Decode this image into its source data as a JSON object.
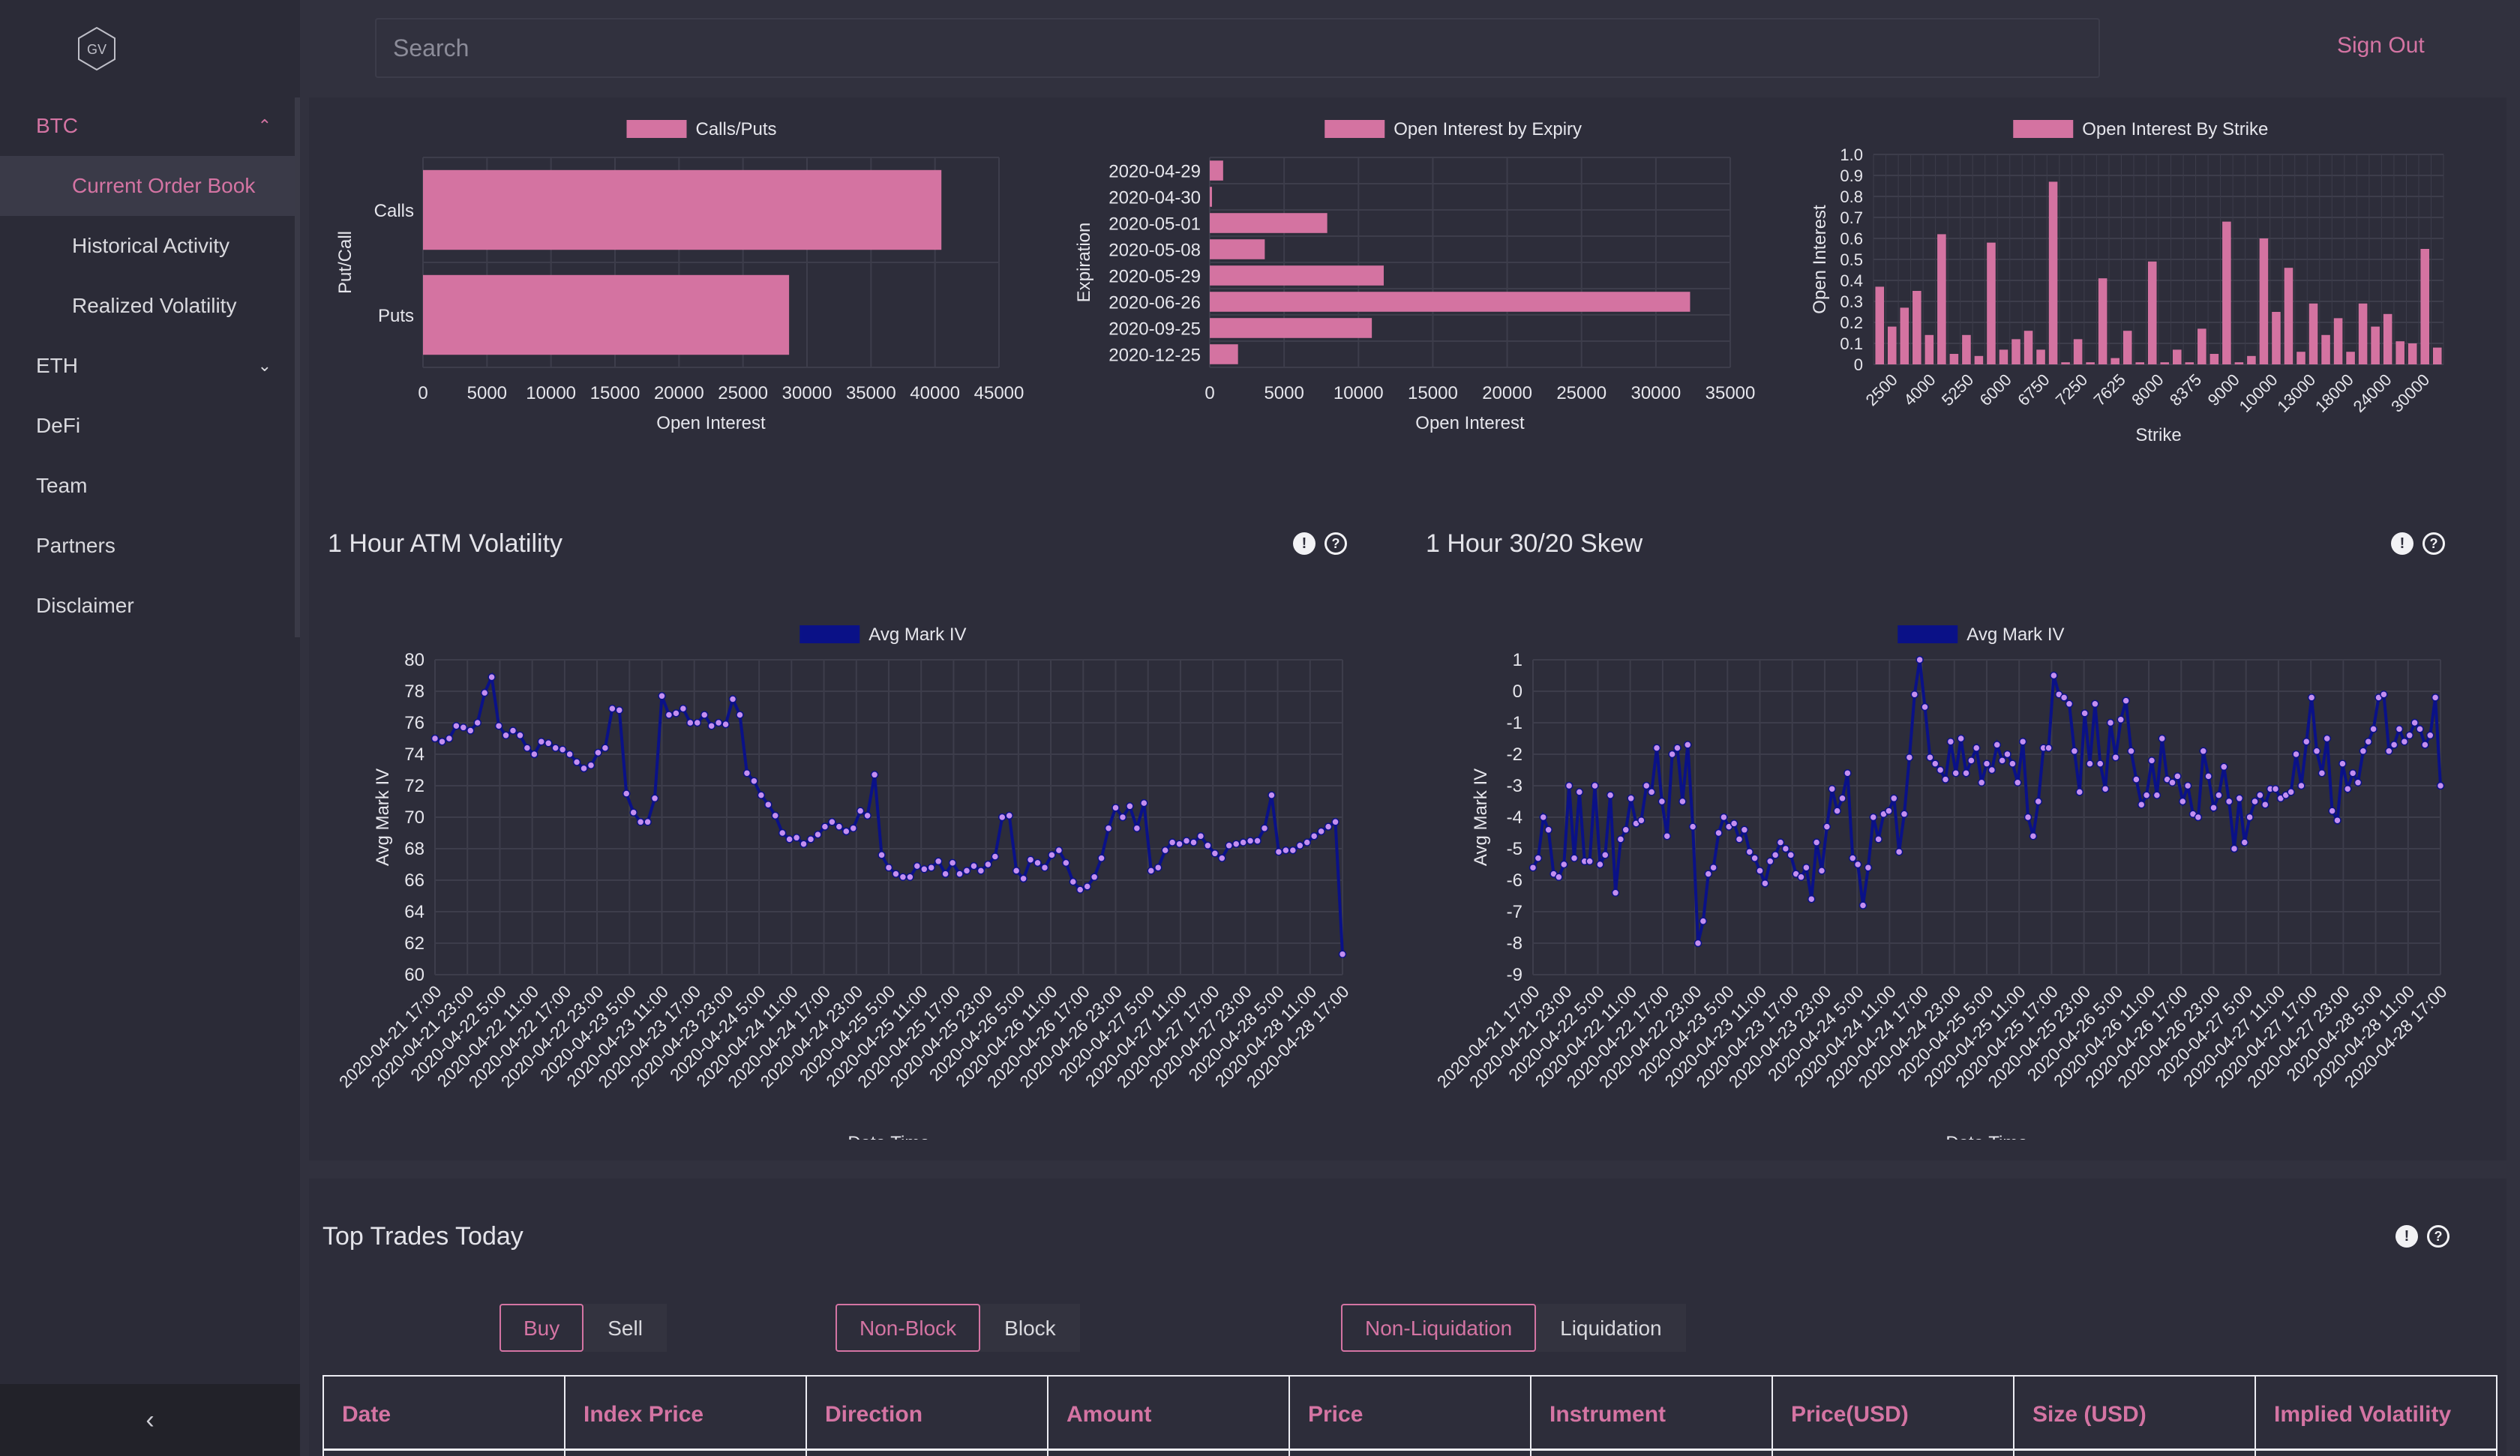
{
  "search": {
    "placeholder": "Search"
  },
  "header": {
    "sign_out": "Sign Out"
  },
  "logo": {
    "text": "GV"
  },
  "sidebar": {
    "groups": [
      {
        "label": "BTC",
        "expanded": true,
        "items": [
          "Current Order Book",
          "Historical Activity",
          "Realized Volatility"
        ],
        "current": "Current Order Book"
      },
      {
        "label": "ETH",
        "expanded": false
      }
    ],
    "links": [
      "DeFi",
      "Team",
      "Partners",
      "Disclaimer"
    ],
    "collapse_icon": "chevron-left-icon"
  },
  "colors": {
    "accent": "#d474a3",
    "bar": "#d473a1",
    "line": "#0a1187",
    "marker": "#c48ef0"
  },
  "chart_data": [
    {
      "type": "bar",
      "orientation": "horizontal",
      "legend": "Calls/Puts",
      "categories": [
        "Calls",
        "Puts"
      ],
      "values": [
        40500,
        28600
      ],
      "xlabel": "Open Interest",
      "ylabel": "Put/Call",
      "xlim": [
        0,
        45000
      ],
      "xticks": [
        0,
        5000,
        10000,
        15000,
        20000,
        25000,
        30000,
        35000,
        40000,
        45000
      ]
    },
    {
      "type": "bar",
      "orientation": "horizontal",
      "legend": "Open Interest by Expiry",
      "categories": [
        "2020-04-29",
        "2020-04-30",
        "2020-05-01",
        "2020-05-08",
        "2020-05-29",
        "2020-06-26",
        "2020-09-25",
        "2020-12-25"
      ],
      "values": [
        900,
        150,
        7900,
        3700,
        11700,
        32300,
        10900,
        1900
      ],
      "xlabel": "Open Interest",
      "ylabel": "Expiration",
      "xlim": [
        0,
        35000
      ],
      "xticks": [
        0,
        5000,
        10000,
        15000,
        20000,
        25000,
        30000,
        35000
      ]
    },
    {
      "type": "bar",
      "legend": "Open Interest By Strike",
      "tick_labels": [
        "2500",
        "4000",
        "5250",
        "6000",
        "6750",
        "7250",
        "7625",
        "8000",
        "8375",
        "9000",
        "10000",
        "13000",
        "18000",
        "24000",
        "30000"
      ],
      "values": [
        0.37,
        0.18,
        0.27,
        0.35,
        0.14,
        0.62,
        0.05,
        0.14,
        0.04,
        0.58,
        0.07,
        0.12,
        0.16,
        0.07,
        0.87,
        0.01,
        0.12,
        0.01,
        0.41,
        0.03,
        0.16,
        0.01,
        0.49,
        0.01,
        0.07,
        0.01,
        0.17,
        0.05,
        0.68,
        0.01,
        0.04,
        0.6,
        0.25,
        0.46,
        0.06,
        0.29,
        0.14,
        0.22,
        0.06,
        0.29,
        0.18,
        0.24,
        0.11,
        0.1,
        0.55,
        0.08
      ],
      "xlabel": "Strike",
      "ylabel": "Open Interest",
      "ylim": [
        0,
        1
      ],
      "yticks": [
        0,
        0.1,
        0.2,
        0.3,
        0.4,
        0.5,
        0.6,
        0.7,
        0.8,
        0.9,
        1.0
      ]
    },
    {
      "type": "line",
      "title": "1 Hour ATM Volatility",
      "legend": "Avg Mark IV",
      "xlabel": "Date Time",
      "ylabel": "Avg Mark IV",
      "ylim": [
        60,
        80
      ],
      "yticks": [
        60,
        62,
        64,
        66,
        68,
        70,
        72,
        74,
        76,
        78,
        80
      ],
      "x_ticks": [
        "2020-04-21 17:00",
        "2020-04-21 23:00",
        "2020-04-22 5:00",
        "2020-04-22 11:00",
        "2020-04-22 17:00",
        "2020-04-22 23:00",
        "2020-04-23 5:00",
        "2020-04-23 11:00",
        "2020-04-23 17:00",
        "2020-04-23 23:00",
        "2020-04-24 5:00",
        "2020-04-24 11:00",
        "2020-04-24 17:00",
        "2020-04-24 23:00",
        "2020-04-25 5:00",
        "2020-04-25 11:00",
        "2020-04-25 17:00",
        "2020-04-25 23:00",
        "2020-04-26 5:00",
        "2020-04-26 11:00",
        "2020-04-26 17:00",
        "2020-04-26 23:00",
        "2020-04-27 5:00",
        "2020-04-27 11:00",
        "2020-04-27 17:00",
        "2020-04-27 23:00",
        "2020-04-28 5:00",
        "2020-04-28 11:00",
        "2020-04-28 17:00"
      ],
      "values": [
        75.0,
        74.8,
        75.0,
        75.8,
        75.7,
        75.5,
        76.0,
        77.9,
        78.9,
        75.8,
        75.2,
        75.5,
        75.2,
        74.4,
        74.0,
        74.8,
        74.7,
        74.4,
        74.3,
        74.0,
        73.5,
        73.1,
        73.3,
        74.1,
        74.4,
        76.9,
        76.8,
        71.5,
        70.3,
        69.7,
        69.7,
        71.2,
        77.7,
        76.5,
        76.6,
        76.9,
        76.0,
        76.0,
        76.5,
        75.8,
        76.0,
        75.9,
        77.5,
        76.5,
        72.8,
        72.3,
        71.4,
        70.8,
        70.1,
        69.0,
        68.6,
        68.7,
        68.3,
        68.6,
        68.9,
        69.4,
        69.7,
        69.4,
        69.1,
        69.3,
        70.4,
        70.1,
        72.7,
        67.6,
        66.8,
        66.4,
        66.2,
        66.2,
        66.9,
        66.7,
        66.8,
        67.2,
        66.4,
        67.1,
        66.4,
        66.6,
        66.9,
        66.6,
        67.0,
        67.5,
        70.0,
        70.1,
        66.6,
        66.1,
        67.3,
        67.1,
        66.8,
        67.6,
        67.9,
        67.1,
        65.9,
        65.4,
        65.6,
        66.2,
        67.4,
        69.3,
        70.6,
        70.0,
        70.7,
        69.3,
        70.9,
        66.6,
        66.8,
        67.9,
        68.4,
        68.3,
        68.5,
        68.4,
        68.8,
        68.2,
        67.7,
        67.4,
        68.2,
        68.3,
        68.4,
        68.5,
        68.5,
        69.3,
        71.4,
        67.8,
        67.9,
        67.9,
        68.2,
        68.4,
        68.8,
        69.1,
        69.4,
        69.7,
        61.3
      ]
    },
    {
      "type": "line",
      "title": "1 Hour 30/20 Skew",
      "legend": "Avg Mark IV",
      "xlabel": "Date Time",
      "ylabel": "Avg Mark IV",
      "ylim": [
        -9,
        1
      ],
      "yticks": [
        -9,
        -8,
        -7,
        -6,
        -5,
        -4,
        -3,
        -2,
        -1,
        0,
        1
      ],
      "x_ticks": [
        "2020-04-21 17:00",
        "2020-04-21 23:00",
        "2020-04-22 5:00",
        "2020-04-22 11:00",
        "2020-04-22 17:00",
        "2020-04-22 23:00",
        "2020-04-23 5:00",
        "2020-04-23 11:00",
        "2020-04-23 17:00",
        "2020-04-23 23:00",
        "2020-04-24 5:00",
        "2020-04-24 11:00",
        "2020-04-24 17:00",
        "2020-04-24 23:00",
        "2020-04-25 5:00",
        "2020-04-25 11:00",
        "2020-04-25 17:00",
        "2020-04-25 23:00",
        "2020-04-26 5:00",
        "2020-04-26 11:00",
        "2020-04-26 17:00",
        "2020-04-26 23:00",
        "2020-04-27 5:00",
        "2020-04-27 11:00",
        "2020-04-27 17:00",
        "2020-04-27 23:00",
        "2020-04-28 5:00",
        "2020-04-28 11:00",
        "2020-04-28 17:00"
      ],
      "values": [
        -5.6,
        -5.3,
        -4.0,
        -4.4,
        -5.8,
        -5.9,
        -5.5,
        -3.0,
        -5.3,
        -3.2,
        -5.4,
        -5.4,
        -3.0,
        -5.5,
        -5.2,
        -3.3,
        -6.4,
        -4.7,
        -4.4,
        -3.4,
        -4.2,
        -4.1,
        -3.0,
        -3.2,
        -1.8,
        -3.5,
        -4.6,
        -2.0,
        -1.8,
        -3.5,
        -1.7,
        -4.3,
        -8.0,
        -7.3,
        -5.8,
        -5.6,
        -4.5,
        -4.0,
        -4.3,
        -4.2,
        -4.7,
        -4.4,
        -5.1,
        -5.3,
        -5.7,
        -6.1,
        -5.4,
        -5.2,
        -4.8,
        -5.0,
        -5.2,
        -5.8,
        -5.9,
        -5.6,
        -6.6,
        -4.8,
        -5.7,
        -4.3,
        -3.1,
        -3.8,
        -3.4,
        -2.6,
        -5.3,
        -5.5,
        -6.8,
        -5.6,
        -4.0,
        -4.7,
        -3.9,
        -3.8,
        -3.4,
        -5.1,
        -3.9,
        -2.1,
        -0.1,
        1.0,
        -0.5,
        -2.1,
        -2.3,
        -2.5,
        -2.8,
        -1.6,
        -2.6,
        -1.5,
        -2.6,
        -2.2,
        -1.8,
        -2.9,
        -2.3,
        -2.5,
        -1.7,
        -2.2,
        -2.0,
        -2.3,
        -2.9,
        -1.6,
        -4.0,
        -4.6,
        -3.5,
        -1.8,
        -1.8,
        0.5,
        -0.1,
        -0.2,
        -0.4,
        -1.9,
        -3.2,
        -0.7,
        -2.3,
        -0.4,
        -2.3,
        -3.1,
        -1.0,
        -2.1,
        -0.9,
        -0.3,
        -1.9,
        -2.8,
        -3.6,
        -3.3,
        -2.2,
        -3.3,
        -1.5,
        -2.8,
        -2.9,
        -2.7,
        -3.5,
        -3.0,
        -3.9,
        -4.0,
        -1.9,
        -2.7,
        -3.7,
        -3.3,
        -2.4,
        -3.5,
        -5.0,
        -3.4,
        -4.8,
        -4.0,
        -3.5,
        -3.3,
        -3.6,
        -3.1,
        -3.1,
        -3.4,
        -3.3,
        -3.2,
        -2.0,
        -3.0,
        -1.6,
        -0.2,
        -1.9,
        -2.6,
        -1.5,
        -3.8,
        -4.1,
        -2.3,
        -3.1,
        -2.6,
        -2.9,
        -1.9,
        -1.6,
        -1.2,
        -0.2,
        -0.1,
        -1.9,
        -1.7,
        -1.2,
        -1.6,
        -1.4,
        -1.0,
        -1.2,
        -1.7,
        -1.4,
        -0.2,
        -3.0
      ]
    }
  ],
  "trades": {
    "title": "Top Trades Today",
    "toggles": [
      {
        "options": [
          "Buy",
          "Sell"
        ],
        "active": "Buy"
      },
      {
        "options": [
          "Non-Block",
          "Block"
        ],
        "active": "Non-Block"
      },
      {
        "options": [
          "Non-Liquidation",
          "Liquidation"
        ],
        "active": "Non-Liquidation"
      }
    ],
    "columns": [
      "Date",
      "Index Price",
      "Direction",
      "Amount",
      "Price",
      "Instrument",
      "Price(USD)",
      "Size (USD)",
      "Implied Volatility"
    ]
  }
}
